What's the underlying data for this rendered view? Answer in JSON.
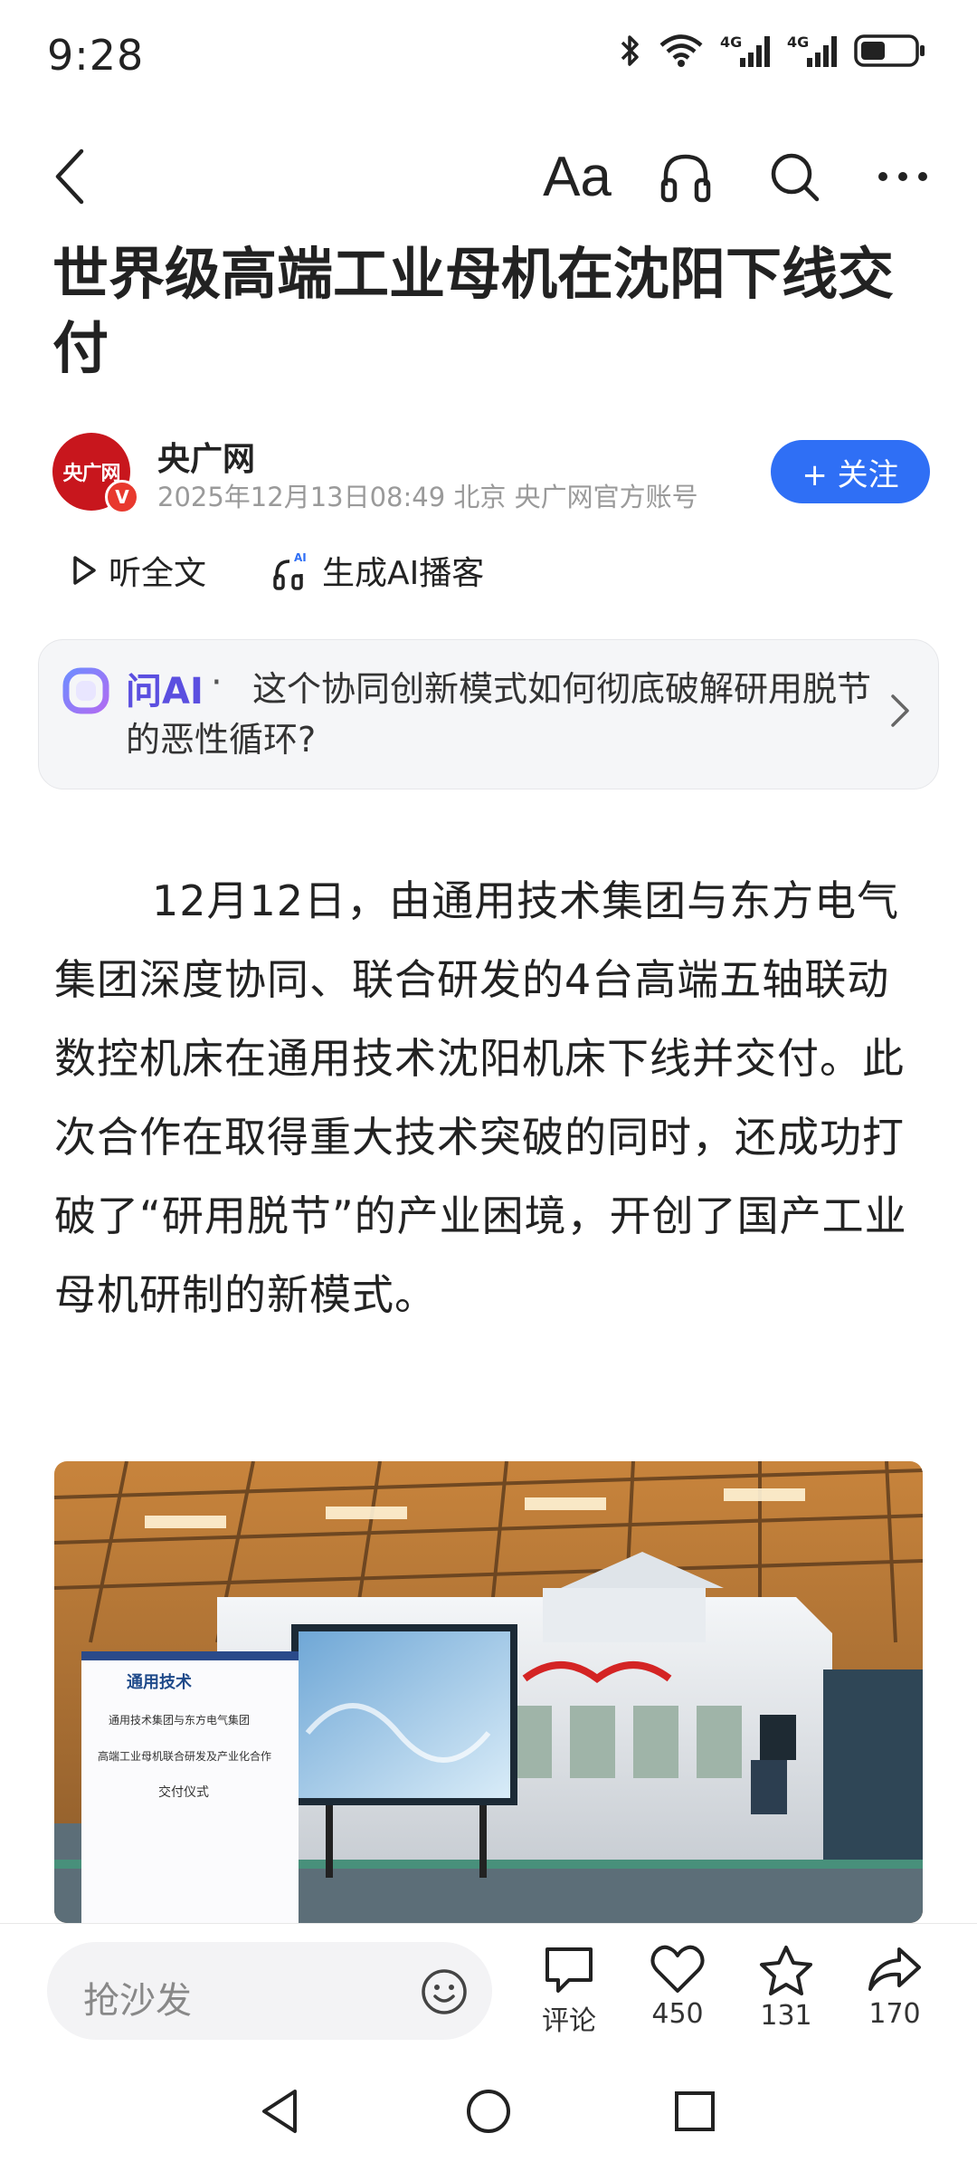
{
  "status": {
    "time": "9:28",
    "icons": [
      "bluetooth-icon",
      "wifi-icon",
      "signal-4g-icon",
      "signal-4g-icon",
      "battery-icon"
    ],
    "network_labels": [
      "4G",
      "4G"
    ]
  },
  "toolbar": {
    "font_label": "Aa",
    "icons": [
      "back-icon",
      "font-size-icon",
      "headphones-icon",
      "search-icon",
      "more-icon"
    ]
  },
  "article": {
    "title": "世界级高端工业母机在沈阳下线交付",
    "author": {
      "avatar_text": "央广网",
      "verified_mark": "V",
      "name": "央广网",
      "meta": "2025年12月13日08:49 北京 央广网官方账号",
      "follow_label": "+ 关注"
    },
    "listen_full": "听全文",
    "ai_podcast": "生成AI播客",
    "ai_podcast_badge": "AI",
    "ai_card": {
      "label": "问AI",
      "dot": "·",
      "question": "这个协同创新模式如何彻底破解研用脱节的恶性循环?"
    },
    "body": "12月12日，由通用技术集团与东方电气集团深度协同、联合研发的4台高端五轴联动数控机床在通用技术沈阳机床下线并交付。此次合作在取得重大技术突破的同时，还成功打破了“研用脱节”的产业困境，开创了国产工业母机研制的新模式。",
    "photo": {
      "logo_text": "通用技术",
      "sign_line1": "通用技术集团与东方电气集团",
      "sign_line2": "高端工业母机联合研发及产业化合作",
      "sign_line3": "交付仪式"
    }
  },
  "bottom_bar": {
    "comment_placeholder": "抢沙发",
    "comment_label": "评论",
    "likes": "450",
    "favorites": "131",
    "shares": "170"
  },
  "colors": {
    "accent": "#2f6ff5",
    "ai_purple": "#5b4fe0",
    "brand_red": "#c8161d"
  }
}
